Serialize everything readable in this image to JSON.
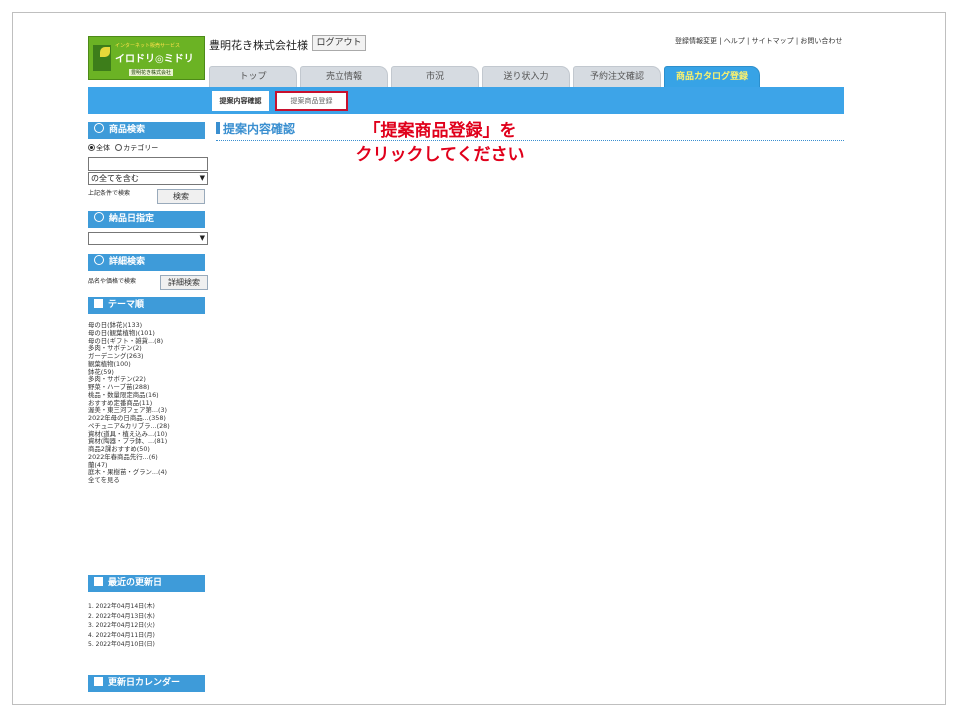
{
  "header": {
    "logo": {
      "sub": "インターネット販売サービス",
      "name": "イロドリ◎ミドリ",
      "company": "豊明花き株式会社"
    },
    "company_user": "豊明花き株式会社様",
    "logout_label": "ログアウト",
    "top_links": "登録情報変更 | ヘルプ | サイトマップ | お問い合わせ"
  },
  "tabs": [
    {
      "label": "トップ"
    },
    {
      "label": "売立情報"
    },
    {
      "label": "市況"
    },
    {
      "label": "送り状入力"
    },
    {
      "label": "予約注文確認"
    },
    {
      "label": "商品カタログ登録"
    }
  ],
  "subtabs": [
    {
      "label": "提案内容確認"
    },
    {
      "label": "提案商品登録"
    }
  ],
  "sidebar": {
    "search": {
      "heading": "商品検索",
      "radio_all": "全体",
      "radio_category": "カテゴリー",
      "condition_select": "の全てを含む",
      "hint": "上記条件で検索",
      "button": "検索"
    },
    "delivery": {
      "heading": "納品日指定"
    },
    "detail": {
      "heading": "詳細検索",
      "hint": "品名や価格で検索",
      "button": "詳細検索"
    },
    "theme": {
      "heading": "テーマ順",
      "items": [
        "母の日(鉢花)(133)",
        "母の日(観葉植物)(101)",
        "母の日(ギフト・雑貨...(8)",
        "多肉・サボテン(2)",
        "ガーデニング(263)",
        "観葉植物(100)",
        "鉢花(59)",
        "多肉・サボテン(22)",
        "野菜・ハーブ苗(288)",
        "桃品・数量限定商品(16)",
        "おすすめ定番商品(11)",
        "渥美・東三河フェア第...(3)",
        "2022年母の日商品...(358)",
        "ペチュニア&カリブラ...(28)",
        "資材(道具・植え込み...(10)",
        "資材(陶器・プラ鉢、...(81)",
        "商品2課おすすめ(50)",
        "2022年春商品先行...(6)",
        "蘭(47)",
        "庭木・果樹苗・グラン...(4)",
        "全てを見る"
      ]
    },
    "recent": {
      "heading": "最近の更新日",
      "items": [
        "1. 2022年04月14日(木)",
        "2. 2022年04月13日(水)",
        "3. 2022年04月12日(火)",
        "4. 2022年04月11日(月)",
        "5. 2022年04月10日(日)"
      ]
    },
    "calendar": {
      "heading": "更新日カレンダー"
    }
  },
  "main": {
    "title": "提案内容確認",
    "instruction_line1": "「提案商品登録」を",
    "instruction_line2": "クリックしてください"
  },
  "colors": {
    "nav_blue": "#3da4e8",
    "instruction_red": "#e0001b",
    "highlight_border": "#c8102e"
  }
}
